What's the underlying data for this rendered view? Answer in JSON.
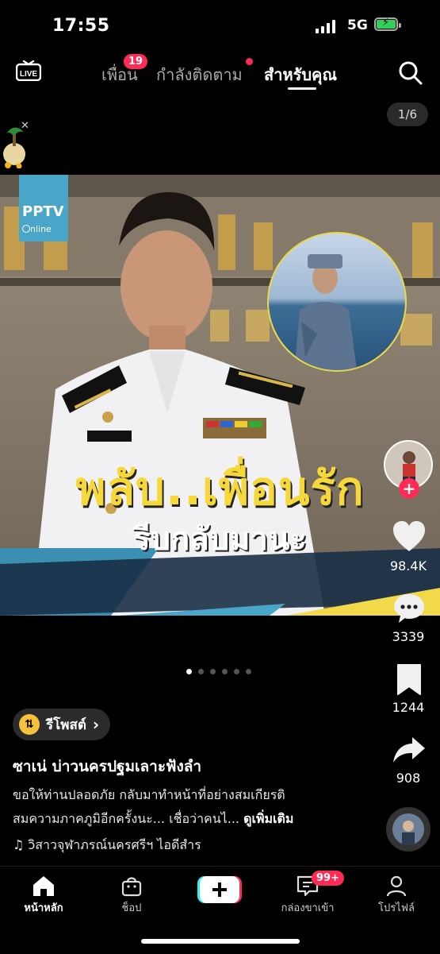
{
  "status": {
    "time": "17:55",
    "network": "5G"
  },
  "nav": {
    "live_label": "LIVE",
    "tabs": [
      {
        "label": "เพื่อน",
        "badge": "19"
      },
      {
        "label": "กำลังติดตาม"
      },
      {
        "label": "สำหรับคุณ"
      }
    ]
  },
  "photo": {
    "counter": "1/6",
    "watermark_title": "PPTV",
    "watermark_sub": "nline",
    "overlay_title": "พลับ..เพื่อนรัก",
    "overlay_sub": "รีบกลับมานะ"
  },
  "rail": {
    "likes": "98.4K",
    "comments": "3339",
    "saves": "1244",
    "shares": "908"
  },
  "post": {
    "repost_label": "รีโพสต์",
    "author": "ซาเน่ บ่าวนครปฐมเลาะฟังลำ",
    "caption_line1": "ขอให้ท่านปลอดภัย กลับมาทำหน้าที่อย่างสมเกียรติ",
    "caption_line2": "สมความภาคภูมิอีกครั้งนะ... เชื่อว่าคนไ...",
    "see_more": "ดูเพิ่มเติม",
    "music": "ɔิสาวจุฬาภรณ์นครศรีฯ ไอดีสำร"
  },
  "bottom_nav": {
    "home": "หน้าหลัก",
    "shop": "ช็อป",
    "inbox": "กล่องขาเข้า",
    "inbox_badge": "99+",
    "profile": "โปรไฟล์"
  },
  "colors": {
    "accent": "#fe2c55",
    "overlay_yellow": "#f7d83b",
    "repost_yellow": "#f6c13a"
  }
}
